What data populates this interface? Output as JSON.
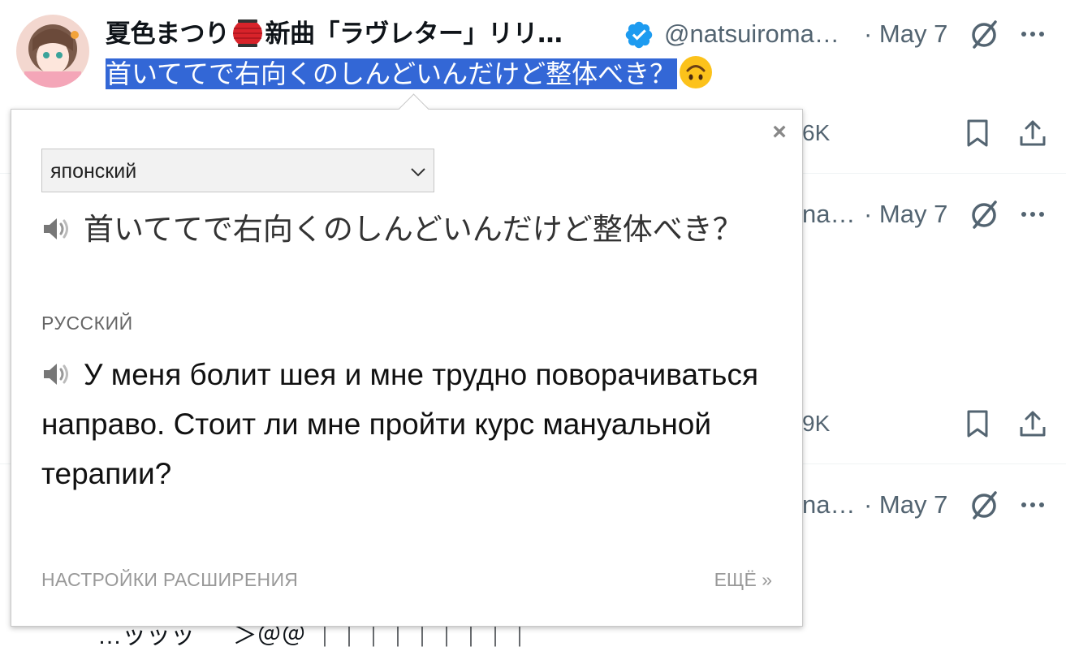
{
  "tweet1": {
    "name_part1": "夏色まつり",
    "name_part2": "新曲「ラヴレター」リリ…",
    "handle": "@natsuiroma…",
    "date": "· May 7",
    "text": "首いててで右向くのしんどいんだけど整体べき？",
    "metric_right": "6K"
  },
  "tweet2": {
    "handle_partial": "na…",
    "date": "· May 7",
    "metric_right": "9K"
  },
  "tweet3": {
    "handle_partial": "na…",
    "date": "· May 7"
  },
  "bottom_partial_text": "…ッッッ ｀ ＞＠＠ ｜｜｜｜｜｜｜｜｜",
  "popup": {
    "close_label": "×",
    "source_lang": "японский",
    "source_text": "首いててで右向くのしんどいんだけど整体べき？",
    "target_lang": "РУССКИЙ",
    "target_text": "У меня болит шея и мне трудно поворачиваться направо. Стоит ли мне пройти курс мануальной терапии?",
    "settings_label": "НАСТРОЙКИ РАСШИРЕНИЯ",
    "more_label": "ЕЩЁ »"
  },
  "colors": {
    "selection": "#3367d6",
    "verified": "#1d9bf0",
    "muted": "#536471"
  },
  "icons": [
    "verified-badge-icon",
    "grok-icon",
    "more-icon",
    "bookmark-icon",
    "share-icon",
    "speaker-icon",
    "chevron-down-icon",
    "close-icon"
  ]
}
